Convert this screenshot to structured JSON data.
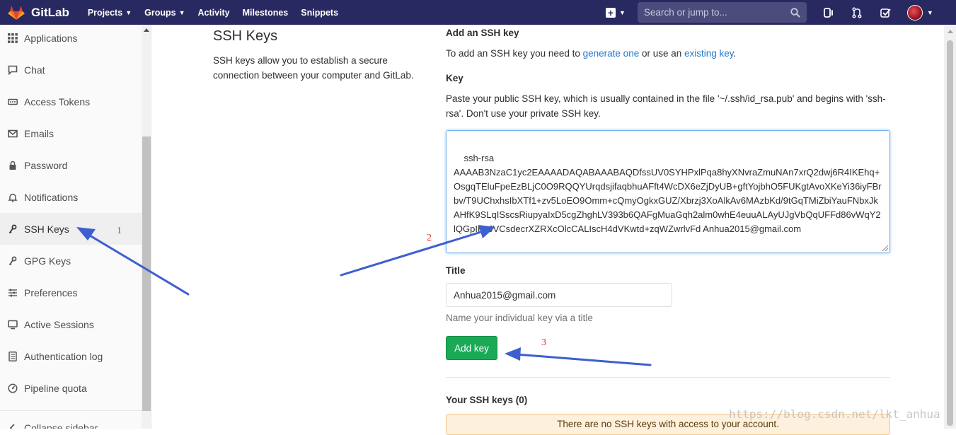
{
  "navbar": {
    "brand": "GitLab",
    "links": [
      "Projects",
      "Groups",
      "Activity",
      "Milestones",
      "Snippets"
    ],
    "search_placeholder": "Search or jump to...",
    "colors": {
      "background": "#292961",
      "search": "#4b4b7c"
    }
  },
  "sidebar": {
    "items": [
      {
        "label": "Applications",
        "icon": "grid-icon"
      },
      {
        "label": "Chat",
        "icon": "chat-icon"
      },
      {
        "label": "Access Tokens",
        "icon": "token-icon"
      },
      {
        "label": "Emails",
        "icon": "envelope-icon"
      },
      {
        "label": "Password",
        "icon": "lock-icon"
      },
      {
        "label": "Notifications",
        "icon": "bell-icon"
      },
      {
        "label": "SSH Keys",
        "icon": "key-icon"
      },
      {
        "label": "GPG Keys",
        "icon": "key-icon"
      },
      {
        "label": "Preferences",
        "icon": "sliders-icon"
      },
      {
        "label": "Active Sessions",
        "icon": "monitor-icon"
      },
      {
        "label": "Authentication log",
        "icon": "log-icon"
      },
      {
        "label": "Pipeline quota",
        "icon": "gauge-icon"
      }
    ],
    "active": "SSH Keys",
    "collapse_label": "Collapse sidebar"
  },
  "left": {
    "title": "SSH Keys",
    "description": "SSH keys allow you to establish a secure connection between your computer and GitLab."
  },
  "form": {
    "heading": "Add an SSH key",
    "intro_prefix": "To add an SSH key you need to ",
    "generate_link": "generate one",
    "intro_middle": " or use an ",
    "existing_link": "existing key",
    "intro_suffix": ".",
    "key_label": "Key",
    "key_help": "Paste your public SSH key, which is usually contained in the file '~/.ssh/id_rsa.pub' and begins with 'ssh-rsa'. Don't use your private SSH key.",
    "key_value": "ssh-rsa\nAAAAB3NzaC1yc2EAAAADAQABAAABAQDfssUV0SYHPxlPqa8hyXNvraZmuNAn7xrQ2dwj6R4IKEhq+OsgqTEluFpeEzBLjC0O9RQQYUrqdsjifaqbhuAFft4WcDX6eZjDyUB+gftYojbhO5FUKgtAvoXKeYi36iyFBrbv/T9UChxhsIbXTf1+zv5LoEO9Omm+cQmyOgkxGUZ/Xbrzj3XoAlkAv6MAzbKd/9tGqTMiZbiYauFNbxJkAHfK9SLqISscsRiupyaIxD5cgZhghLV393b6QAFgMuaGqh2alm0whE4euuALAyUJgVbQqUFFd86vWqY2lQGpIKvJVCsdecrXZRXcOlcCALIscH4dVKwtd+zqWZwrlvFd Anhua2015@gmail.com",
    "title_label": "Title",
    "title_value": "Anhua2015@gmail.com",
    "title_help": "Name your individual key via a title",
    "add_button": "Add key",
    "your_keys": "Your SSH keys (0)",
    "no_keys": "There are no SSH keys with access to your account.",
    "button_color": "#1aaa55",
    "link_color": "#1f78d1"
  },
  "annotations": {
    "numbers": [
      "1",
      "2",
      "3"
    ],
    "arrow_color": "#3d5fd0",
    "watermark": "https://blog.csdn.net/lkt_anhua"
  }
}
